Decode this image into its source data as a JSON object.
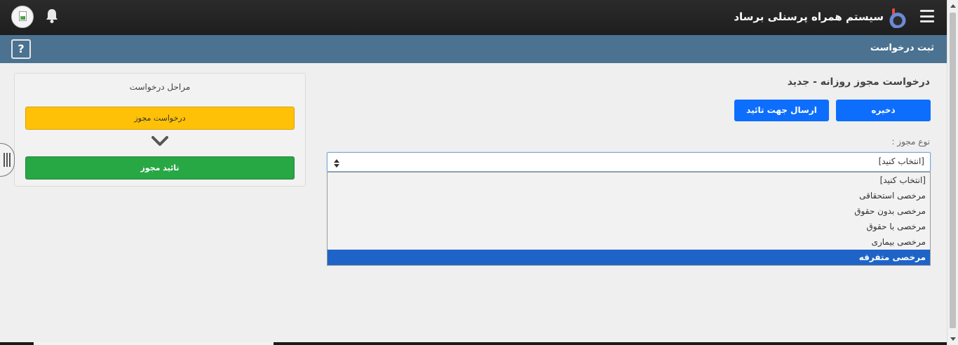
{
  "header": {
    "app_title": "سیستم همراه پرسنلی برساد",
    "page_title": "ثبت درخواست",
    "help_label": "?"
  },
  "steps": {
    "title": "مراحل درخواست",
    "items": [
      {
        "label": "درخواست مجوز",
        "color": "#ffc107"
      },
      {
        "label": "تائید مجوز",
        "color": "#28a745"
      }
    ]
  },
  "form": {
    "title": "درخواست مجوز روزانه - جدید",
    "save_label": "ذخیره",
    "send_label": "ارسال جهت تائید",
    "field_label": "نوع مجوز :",
    "select_value": "[انتخاب کنید]",
    "options": [
      "[انتخاب کنید]",
      "مرخصی استحقاقی",
      "مرخصی بدون حقوق",
      "مرخصی با حقوق",
      "مرخصی بیماری",
      "مرخصی متفرقه"
    ],
    "highlighted_option": "مرخصی متفرقه"
  },
  "colors": {
    "topbar": "#232323",
    "subbar": "#4b7291",
    "primary": "#0d6efd",
    "highlight": "#1e64c8"
  },
  "icons": [
    "hamburger-icon",
    "app-logo-icon",
    "bell-icon",
    "avatar-icon",
    "help-icon",
    "chevron-down-icon",
    "select-updown-icon",
    "side-handle-icon"
  ]
}
